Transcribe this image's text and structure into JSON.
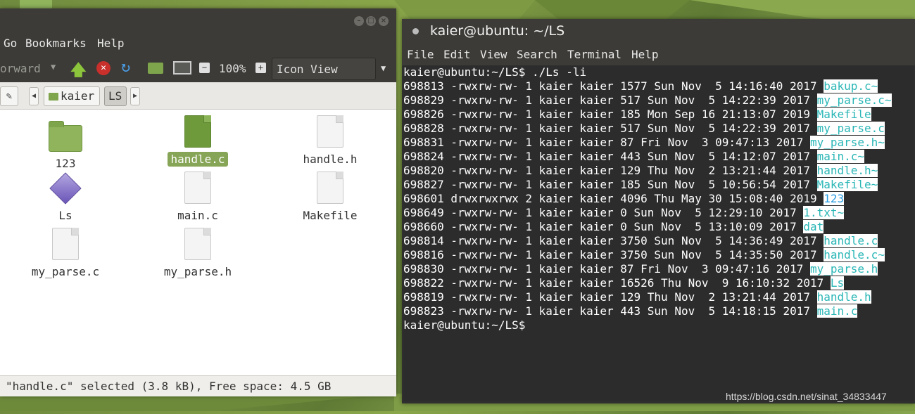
{
  "file_manager": {
    "menu": [
      "Go",
      "Bookmarks",
      "Help"
    ],
    "toolbar": {
      "forward_label": "orward",
      "zoom": "100%",
      "view_mode": "Icon View"
    },
    "path": [
      "kaier",
      "LS"
    ],
    "items": [
      {
        "name": "123",
        "kind": "folder",
        "selected": false
      },
      {
        "name": "handle.c",
        "kind": "c-file",
        "selected": true
      },
      {
        "name": "handle.h",
        "kind": "document",
        "selected": false
      },
      {
        "name": "Ls",
        "kind": "executable",
        "selected": false
      },
      {
        "name": "main.c",
        "kind": "document",
        "selected": false
      },
      {
        "name": "Makefile",
        "kind": "document",
        "selected": false
      },
      {
        "name": "my_parse.c",
        "kind": "document",
        "selected": false
      },
      {
        "name": "my_parse.h",
        "kind": "document",
        "selected": false
      }
    ],
    "status": "\"handle.c\" selected (3.8 kB), Free space: 4.5 GB"
  },
  "terminal": {
    "title": "kaier@ubuntu: ~/LS",
    "menu": [
      "File",
      "Edit",
      "View",
      "Search",
      "Terminal",
      "Help"
    ],
    "command_line": "kaier@ubuntu:~/LS$ ./Ls -li",
    "rows": [
      {
        "text": "698813 -rwxrw-rw- 1 kaier kaier 1577 Sun Nov  5 14:16:40 2017 ",
        "file": "bakup.c~"
      },
      {
        "text": "698829 -rwxrw-rw- 1 kaier kaier 517 Sun Nov  5 14:22:39 2017 ",
        "file": "my_parse.c~"
      },
      {
        "text": "698826 -rwxrw-rw- 1 kaier kaier 185 Mon Sep 16 21:13:07 2019 ",
        "file": "Makefile"
      },
      {
        "text": "698828 -rwxrw-rw- 1 kaier kaier 517 Sun Nov  5 14:22:39 2017 ",
        "file": "my_parse.c"
      },
      {
        "text": "698831 -rwxrw-rw- 1 kaier kaier 87 Fri Nov  3 09:47:13 2017 ",
        "file": "my_parse.h~"
      },
      {
        "text": "698824 -rwxrw-rw- 1 kaier kaier 443 Sun Nov  5 14:12:07 2017 ",
        "file": "main.c~"
      },
      {
        "text": "698820 -rwxrw-rw- 1 kaier kaier 129 Thu Nov  2 13:21:44 2017 ",
        "file": "handle.h~"
      },
      {
        "text": "698827 -rwxrw-rw- 1 kaier kaier 185 Sun Nov  5 10:56:54 2017 ",
        "file": "Makefile~"
      },
      {
        "text": "698601 drwxrwxrwx 2 kaier kaier 4096 Thu May 30 15:08:40 2019 ",
        "file": "123"
      },
      {
        "text": "698649 -rwxrw-rw- 1 kaier kaier 0 Sun Nov  5 12:29:10 2017 ",
        "file": "1.txt~"
      },
      {
        "text": "698660 -rwxrw-rw- 1 kaier kaier 0 Sun Nov  5 13:10:09 2017 ",
        "file": "dat"
      },
      {
        "text": "698814 -rwxrw-rw- 1 kaier kaier 3750 Sun Nov  5 14:36:49 2017 ",
        "file": "handle.c"
      },
      {
        "text": "698816 -rwxrw-rw- 1 kaier kaier 3750 Sun Nov  5 14:35:50 2017 ",
        "file": "handle.c~"
      },
      {
        "text": "698830 -rwxrw-rw- 1 kaier kaier 87 Fri Nov  3 09:47:16 2017 ",
        "file": "my_parse.h"
      },
      {
        "text": "698822 -rwxrw-rw- 1 kaier kaier 16526 Thu Nov  9 16:10:32 2017 ",
        "file": "Ls"
      },
      {
        "text": "698819 -rwxrw-rw- 1 kaier kaier 129 Thu Nov  2 13:21:44 2017 ",
        "file": "handle.h"
      },
      {
        "text": "698823 -rwxrw-rw- 1 kaier kaier 443 Sun Nov  5 14:18:15 2017 ",
        "file": "main.c"
      }
    ],
    "prompt": "kaier@ubuntu:~/LS$"
  },
  "watermark": "https://blog.csdn.net/sinat_34833447",
  "colors": {
    "accent": "#87a556",
    "terminal_bg": "#2c2c2c",
    "filename": "#2ab6b6"
  }
}
